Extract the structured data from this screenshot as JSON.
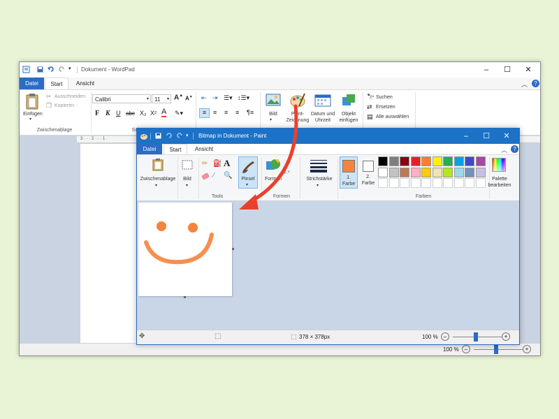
{
  "wordpad": {
    "title": "Dokument - WordPad",
    "tabs": [
      "Datei",
      "Start",
      "Ansicht"
    ],
    "clipboard": {
      "paste": "Einfügen",
      "cut": "Ausschneiden",
      "copy": "Kopieren",
      "group": "Zwischenablage"
    },
    "font": {
      "name": "Calibri",
      "size": "11",
      "bold": "F",
      "italic": "K",
      "underline": "U",
      "strike": "abc"
    },
    "font_group": "Schr",
    "insert": {
      "picture": "Bild",
      "paint": "Paint-\nZeichnung",
      "datetime": "Datum und\nUhrzeit",
      "object": "Objekt\neinfügen"
    },
    "editing": {
      "find": "Suchen",
      "replace": "Ersetzen",
      "select_all": "Alle auswählen"
    },
    "ruler_text": "3 · · · 2 · · · 1 ·",
    "zoom": "100 %"
  },
  "paint": {
    "title": "Bitmap in Dokument - Paint",
    "tabs": [
      "Datei",
      "Start",
      "Ansicht"
    ],
    "groups": {
      "clipboard": "Zwischenablage",
      "image": "Bild",
      "tools": "Tools",
      "brush": "Pinsel",
      "shapes": "Formen",
      "shapes_group": "Formen",
      "stroke": "Strichstärke",
      "color1": "1.\nFarbe",
      "color2": "2.\nFarbe",
      "colors_group": "Farben",
      "edit_palette": "Palette\nbearbeiten"
    },
    "color1": "#f5843c",
    "color2": "#ffffff",
    "palette_row1": [
      "#000000",
      "#7f7f7f",
      "#880015",
      "#ed1c24",
      "#ff7f27",
      "#fff200",
      "#22b14c",
      "#00a2e8",
      "#3f48cc",
      "#a349a4"
    ],
    "palette_row2": [
      "#ffffff",
      "#c3c3c3",
      "#b97a57",
      "#ffaec9",
      "#ffc90e",
      "#efe4b0",
      "#b5e61d",
      "#99d9ea",
      "#7092be",
      "#c8bfe7"
    ],
    "dimensions": "378 × 378px",
    "zoom": "100 %"
  },
  "colors": {
    "accent": "#2b6cc4",
    "arrow": "#e8412c",
    "smile": "#f5843c"
  }
}
